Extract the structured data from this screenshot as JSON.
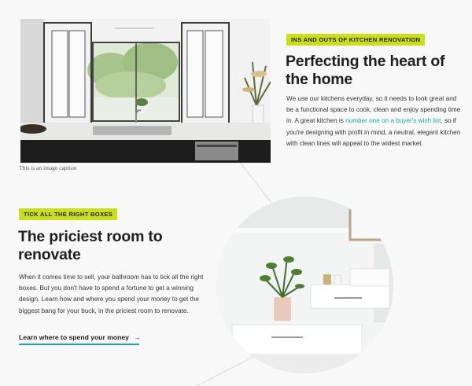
{
  "image_caption": "This is an image caption",
  "kitchen_section": {
    "tag": "INS AND OUTS OF KITCHEN RENOVATION",
    "heading": "Perfecting the heart of the home",
    "body_before": "We use our kitchens everyday, so it needs to look great and be a functional space to cook, clean and enjoy spending time in. A great kitchen is ",
    "link_text": "number one on a buyer's wish list",
    "body_after": ", so if you're designing with profit in mind, a neutral, elegant kitchen with clean lines will appeal to the widest market."
  },
  "bathroom_section": {
    "tag": "TICK ALL THE RIGHT BOXES",
    "heading": "The priciest room to renovate",
    "body": "When it comes time to sell, your bathroom has to tick all the right boxes. But you don't have to spend a fortune to get a winning design. Learn how and where you spend your money to get the biggest bang for your buck, in the priciest room to renovate.",
    "cta_label": "Learn where to spend your money",
    "cta_arrow": "→"
  },
  "colors": {
    "accent_tag": "#c9df1e",
    "link": "#17a6b9"
  },
  "icons": [
    "arrow-right-icon"
  ]
}
